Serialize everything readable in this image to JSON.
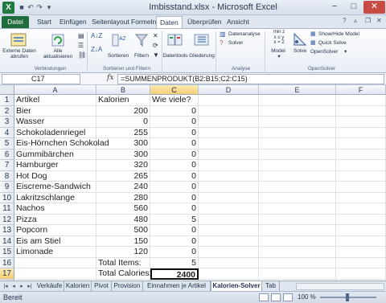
{
  "window": {
    "title": "Imbisstand.xlsx - Microsoft Excel",
    "app_icon": "X",
    "minimize": "−",
    "maximize": "□",
    "close": "✕"
  },
  "ribbon_tabs": [
    "Datei",
    "Start",
    "Einfügen",
    "Seitenlayout",
    "Formeln",
    "Daten",
    "Überprüfen",
    "Ansicht"
  ],
  "active_tab": "Daten",
  "ribbon": {
    "externe_daten": "Externe Daten\nabrufen",
    "alle_aktualisieren": "Alle\naktualisieren",
    "group_verbindungen": "Verbindungen",
    "sortieren": "Sortieren",
    "filtern": "Filtern",
    "group_sortieren_filtern": "Sortieren und Filtern",
    "datentools": "Datentools",
    "gliederung": "Gliederung",
    "datenanalyse": "Datenanalyse",
    "solver": "Solver",
    "group_analyse": "Analyse",
    "model": "Model",
    "solve": "Solve",
    "show_hide_model": "Show/Hide Model",
    "quick_solve": "Quick Solve",
    "opensolver": "OpenSolver",
    "group_opensolver": "OpenSolver",
    "model_glyph": "min z\nx ≤ y\nx = 2"
  },
  "formula_bar": {
    "name_box": "C17",
    "fx": "fx",
    "formula": "=SUMMENPRODUKT(B2:B15;C2:C15)"
  },
  "columns": [
    "A",
    "B",
    "C",
    "D",
    "E",
    "F"
  ],
  "selected_column": "C",
  "rows": [
    {
      "n": "1",
      "a": "Artikel",
      "b": "Kalorien",
      "c": "Wie viele?"
    },
    {
      "n": "2",
      "a": "Bier",
      "b": "200",
      "c": "0"
    },
    {
      "n": "3",
      "a": "Wasser",
      "b": "0",
      "c": "0"
    },
    {
      "n": "4",
      "a": "Schokoladenriegel",
      "b": "255",
      "c": "0"
    },
    {
      "n": "5",
      "a": "Eis-Hörnchen Schokolad",
      "b": "300",
      "c": "0"
    },
    {
      "n": "6",
      "a": "Gummibärchen",
      "b": "300",
      "c": "0"
    },
    {
      "n": "7",
      "a": "Hamburger",
      "b": "320",
      "c": "0"
    },
    {
      "n": "8",
      "a": "Hot Dog",
      "b": "265",
      "c": "0"
    },
    {
      "n": "9",
      "a": "Eiscreme-Sandwich",
      "b": "240",
      "c": "0"
    },
    {
      "n": "10",
      "a": "Lakritzschlange",
      "b": "280",
      "c": "0"
    },
    {
      "n": "11",
      "a": "Nachos",
      "b": "560",
      "c": "0"
    },
    {
      "n": "12",
      "a": "Pizza",
      "b": "480",
      "c": "5"
    },
    {
      "n": "13",
      "a": "Popcorn",
      "b": "500",
      "c": "0"
    },
    {
      "n": "14",
      "a": "Eis am Stiel",
      "b": "150",
      "c": "0"
    },
    {
      "n": "15",
      "a": "Limonade",
      "b": "120",
      "c": "0"
    },
    {
      "n": "16",
      "a": "",
      "b": "Total Items:",
      "c": "5"
    },
    {
      "n": "17",
      "a": "",
      "b": "Total Calories:",
      "c": "2400"
    },
    {
      "n": "18",
      "a": "",
      "b": "",
      "c": ""
    }
  ],
  "sheet_tabs": [
    "Verkäufe",
    "Kalorien",
    "Pivot",
    "Provision",
    "Einnahmen je Artikel",
    "Kalorien-Solver",
    "Tab"
  ],
  "active_sheet": "Kalorien-Solver",
  "status": {
    "text": "Bereit",
    "zoom": "100 %"
  }
}
